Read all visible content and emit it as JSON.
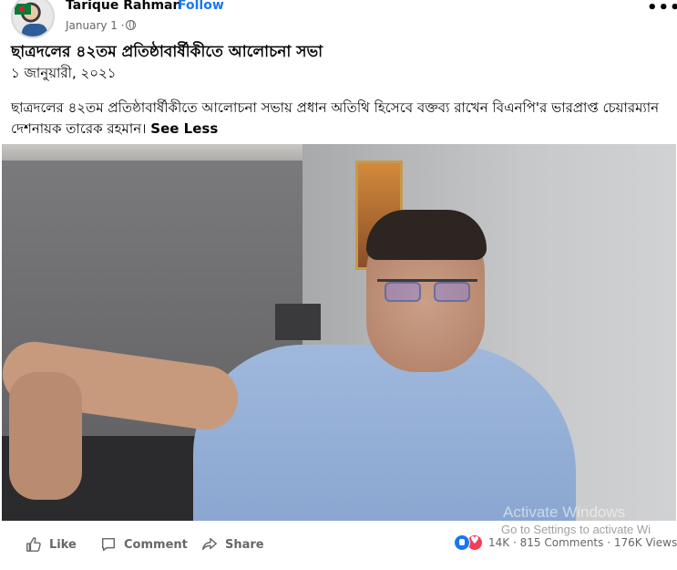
{
  "post": {
    "author": "Tarique Rahman",
    "separator": "·",
    "follow_label": "Follow",
    "timestamp": "January 1 ·",
    "privacy_icon": "globe-icon",
    "menu_label": "•••",
    "title": "ছাত্রদলের ৪২তম প্রতিষ্ঠাবার্ষীকীতে আলোচনা সভা",
    "date": "১ জানুয়ারী, ২০২১",
    "body": "ছাত্রদলের ৪২তম প্রতিষ্ঠাবার্ষীকীতে আলোচনা সভায় প্রধান অতিথি হিসেবে বক্তব্য রাখেন বিএনপি'র ভারপ্রাপ্ত চেয়ারম্যান দেশনায়ক তারেক রহমান।",
    "see_less": "See Less"
  },
  "actions": {
    "like": "Like",
    "comment": "Comment",
    "share": "Share"
  },
  "stats": {
    "reactions": "14K",
    "comments": "815 Comments",
    "views": "176K Views",
    "separator": "·"
  },
  "watermark": {
    "line1": "Activate Windows",
    "line2": "Go to Settings to activate Wi"
  },
  "colors": {
    "accent": "#1877f2",
    "secondary_text": "#65676b",
    "love": "#f33e58"
  }
}
